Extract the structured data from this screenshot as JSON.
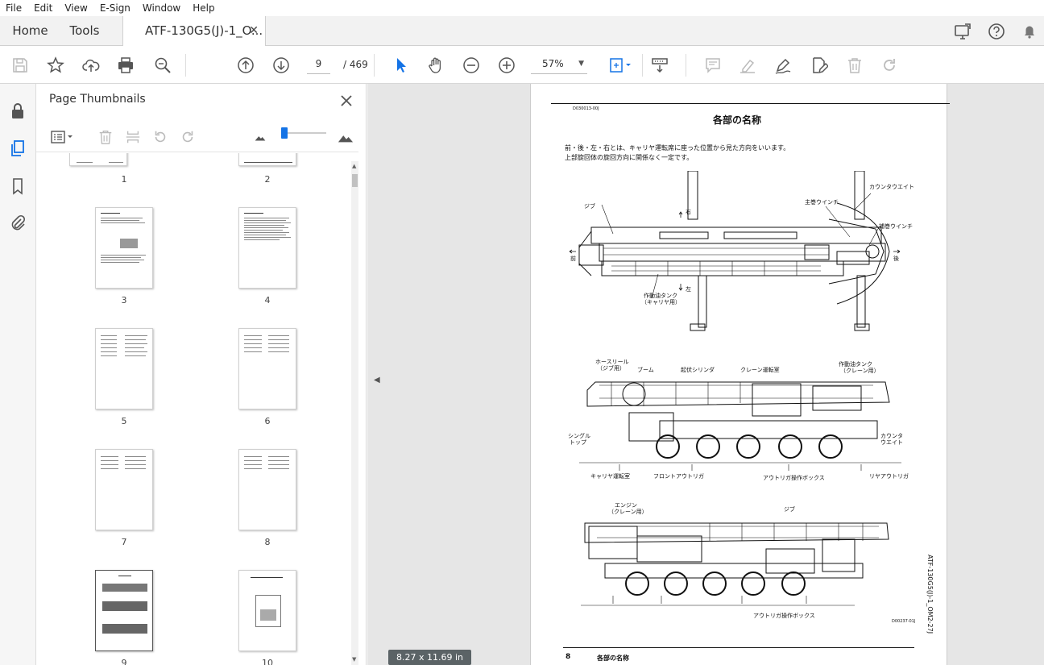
{
  "menu": [
    "File",
    "Edit",
    "View",
    "E-Sign",
    "Window",
    "Help"
  ],
  "tabs": {
    "home": "Home",
    "tools": "Tools",
    "document": "ATF-130G5(J)-1_O..."
  },
  "toolbar": {
    "current_page": "9",
    "total_pages": "/ 469",
    "zoom": "57%"
  },
  "panel": {
    "title": "Page Thumbnails",
    "thumbnails": [
      "1",
      "2",
      "3",
      "4",
      "5",
      "6",
      "7",
      "8",
      "9",
      "10"
    ]
  },
  "page": {
    "code": "D030013-00J",
    "title": "各部の名称",
    "intro1": "前・後・左・右とは、キャリヤ運転席に座った位置から見た方向をいいます。",
    "intro2": "上部旋回体の旋回方向に関係なく一定です。",
    "top_labels": {
      "jib": "ジブ",
      "right": "右",
      "main_winch": "主巻ウインチ",
      "counterweight": "カウンタウエイト",
      "aux_winch": "補巻ウインチ",
      "front": "前",
      "rear": "後",
      "left": "左",
      "tank_carrier_1": "作動油タンク",
      "tank_carrier_2": "（キャリヤ用）"
    },
    "side_labels": {
      "hose_reel_1": "ホースリール",
      "hose_reel_2": "（ジブ用）",
      "boom": "ブーム",
      "derrick_cyl": "起伏シリンダ",
      "crane_cab": "クレーン運転室",
      "tank_crane_1": "作動油タンク",
      "tank_crane_2": "（クレーン用）",
      "single_top_1": "シングル",
      "single_top_2": "トップ",
      "counterweight_1": "カウンタ",
      "counterweight_2": "ウエイト",
      "carrier_cab": "キャリヤ運転室",
      "front_outrigger": "フロントアウトリガ",
      "outrigger_box": "アウトリガ操作ボックス",
      "rear_outrigger": "リヤアウトリガ"
    },
    "side2_labels": {
      "engine_1": "エンジン",
      "engine_2": "（クレーン用）",
      "jib": "ジブ",
      "outrigger_box": "アウトリガ操作ボックス",
      "fig_code": "D00237-01J"
    },
    "vertical_code": "ATF-130G5(J)-1_OM2-27J",
    "footer_num": "8",
    "footer_title": "各部の名称"
  },
  "status": {
    "page_size": "8.27 x 11.69 in"
  },
  "colors": {
    "accent": "#1473e6",
    "doc_bg": "#e6e6e6"
  }
}
